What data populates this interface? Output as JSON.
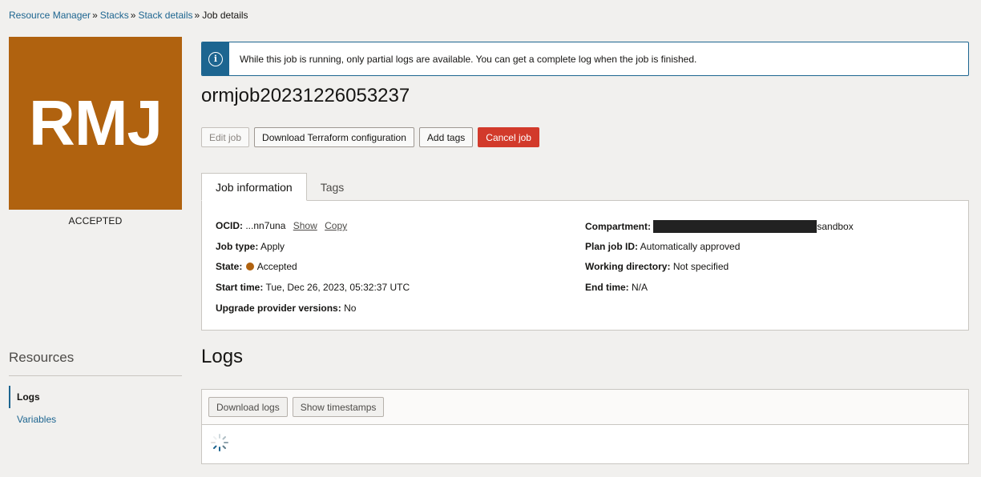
{
  "breadcrumb": {
    "items": [
      "Resource Manager",
      "Stacks",
      "Stack details"
    ],
    "current": "Job details",
    "separator": "»"
  },
  "avatar": {
    "initials": "RMJ",
    "status": "ACCEPTED",
    "color": "#b0620f"
  },
  "resources": {
    "title": "Resources",
    "items": [
      {
        "label": "Logs",
        "active": true
      },
      {
        "label": "Variables",
        "active": false
      }
    ]
  },
  "banner": {
    "icon": "info-icon",
    "text": "While this job is running, only partial logs are available. You can get a complete log when the job is finished."
  },
  "job": {
    "title": "ormjob20231226053237"
  },
  "actions": {
    "edit": "Edit job",
    "download_tf": "Download Terraform configuration",
    "add_tags": "Add tags",
    "cancel": "Cancel job"
  },
  "tabs": {
    "job_info": "Job information",
    "tags": "Tags"
  },
  "info": {
    "ocid_label": "OCID:",
    "ocid_value": "...nn7una",
    "show": "Show",
    "copy": "Copy",
    "job_type_label": "Job type:",
    "job_type_value": "Apply",
    "state_label": "State:",
    "state_value": "Accepted",
    "start_time_label": "Start time:",
    "start_time_value": "Tue, Dec 26, 2023, 05:32:37 UTC",
    "upgrade_label": "Upgrade provider versions:",
    "upgrade_value": "No",
    "compartment_label": "Compartment:",
    "compartment_value": "sandbox",
    "plan_job_label": "Plan job ID:",
    "plan_job_value": "Automatically approved",
    "working_dir_label": "Working directory:",
    "working_dir_value": "Not specified",
    "end_time_label": "End time:",
    "end_time_value": "N/A"
  },
  "logs": {
    "title": "Logs",
    "download": "Download logs",
    "timestamps": "Show timestamps"
  }
}
